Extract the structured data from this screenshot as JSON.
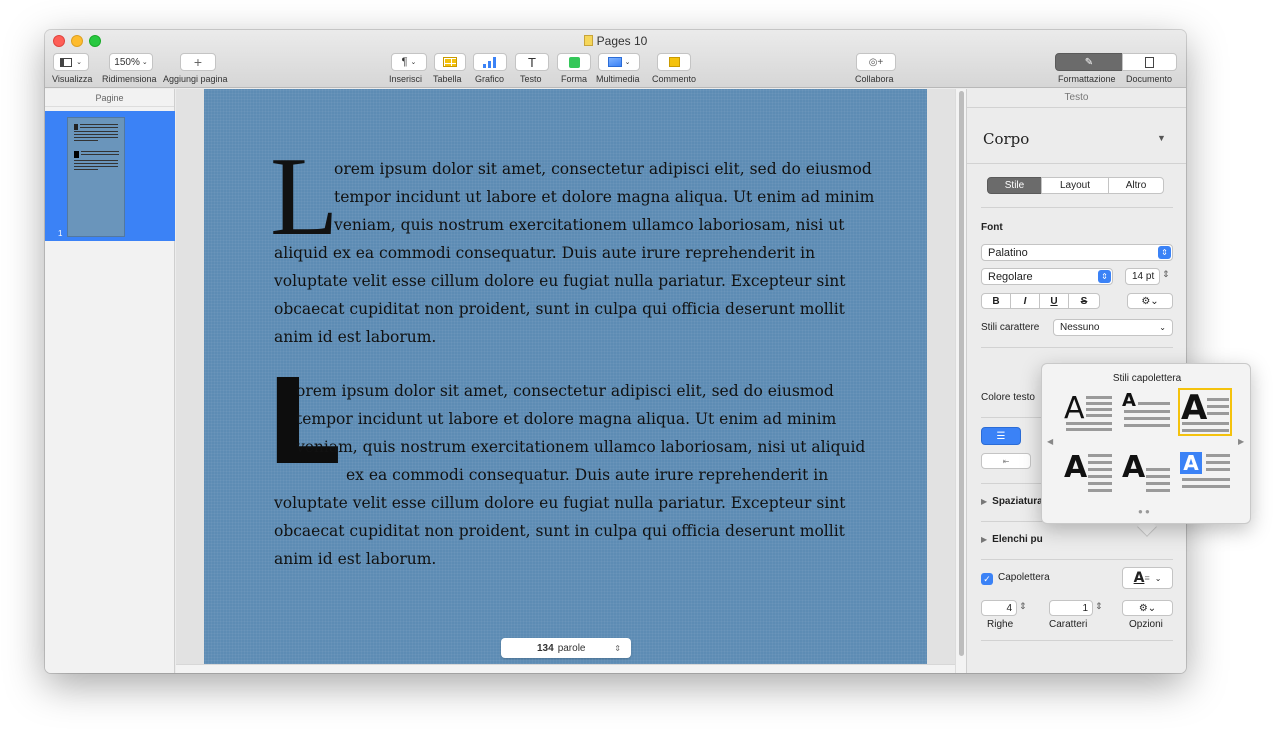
{
  "window": {
    "title": "Pages 10"
  },
  "toolbar": {
    "view_label": "Visualizza",
    "zoom_value": "150%",
    "zoom_label": "Ridimensiona",
    "add_page_label": "Aggiungi pagina",
    "insert_label": "Inserisci",
    "table_label": "Tabella",
    "chart_label": "Grafico",
    "text_label": "Testo",
    "shape_label": "Forma",
    "media_label": "Multimedia",
    "comment_label": "Commento",
    "collaborate_label": "Collabora",
    "format_label": "Formattazione",
    "document_label": "Documento"
  },
  "sidebar": {
    "title": "Pagine",
    "page_number": "1"
  },
  "document": {
    "para1": {
      "drop_cap": "L",
      "lines": [
        "orem ipsum dolor sit amet, consectetur adipisci elit, sed do eiusmod",
        "tempor incidunt ut labore et dolore magna aliqua. Ut enim ad minim",
        "veniam, quis nostrum exercitationem ullamco laboriosam, nisi ut",
        "aliquid ex ea commodi consequatur. Duis aute irure reprehenderit in",
        "voluptate velit esse cillum dolore eu fugiat nulla pariatur. Excepteur sint",
        "obcaecat cupiditat non proident, sunt in culpa qui officia deserunt mollit",
        "anim id est laborum."
      ]
    },
    "para2": {
      "drop_cap": "L",
      "lines": [
        "orem ipsum dolor sit amet, consectetur adipisci elit, sed do eiusmod",
        "tempor incidunt ut labore et dolore magna aliqua. Ut enim ad minim",
        "veniam, quis nostrum exercitationem ullamco laboriosam, nisi ut aliquid",
        "ex ea commodi consequatur. Duis aute irure reprehenderit in",
        "voluptate velit esse cillum dolore eu fugiat nulla pariatur. Excepteur sint",
        "obcaecat cupiditat non proident, sunt in culpa qui officia deserunt mollit",
        "anim id est laborum."
      ]
    },
    "word_count": "134",
    "word_count_unit": "parole"
  },
  "inspector": {
    "title": "Testo",
    "paragraph_style": "Corpo",
    "tabs": [
      "Stile",
      "Layout",
      "Altro"
    ],
    "font_section": "Font",
    "font_family": "Palatino",
    "font_weight": "Regolare",
    "font_size": "14 pt",
    "bold": "B",
    "italic": "I",
    "underline": "U",
    "strike": "S",
    "char_styles_label": "Stili carattere",
    "char_styles_value": "Nessuno",
    "text_color_label": "Colore testo",
    "spacing_label": "Spaziatura",
    "lists_label": "Elenchi pu",
    "drop_cap_label": "Capolettera",
    "lines_value": "4",
    "lines_label": "Righe",
    "chars_value": "1",
    "chars_label": "Caratteri",
    "options_label": "Opzioni"
  },
  "popover": {
    "title": "Stili capolettera",
    "glyph": "A"
  }
}
